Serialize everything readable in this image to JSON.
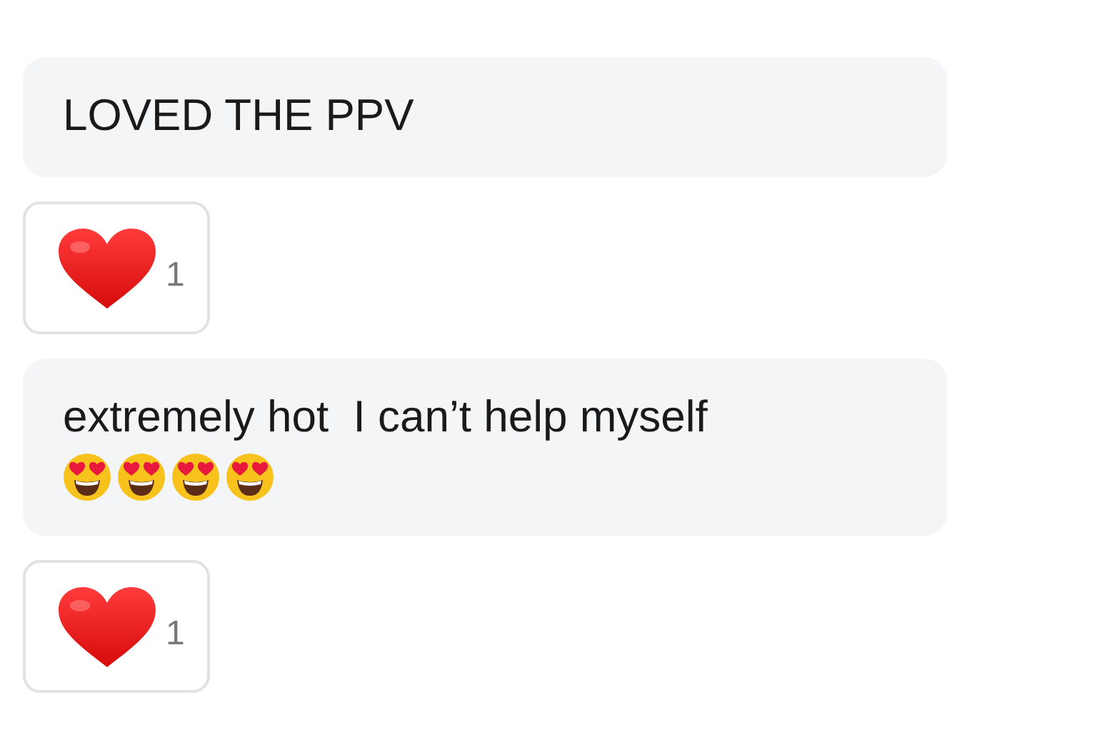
{
  "messages": [
    {
      "text": "LOVED THE PPV",
      "reaction": {
        "kind": "heart",
        "count": "1"
      }
    },
    {
      "text": "extremely hot  I can’t help myself",
      "emojis": [
        {
          "kind": "heart-eyes"
        },
        {
          "kind": "heart-eyes"
        },
        {
          "kind": "heart-eyes"
        },
        {
          "kind": "heart-eyes"
        }
      ],
      "reaction": {
        "kind": "heart",
        "count": "1"
      }
    }
  ]
}
